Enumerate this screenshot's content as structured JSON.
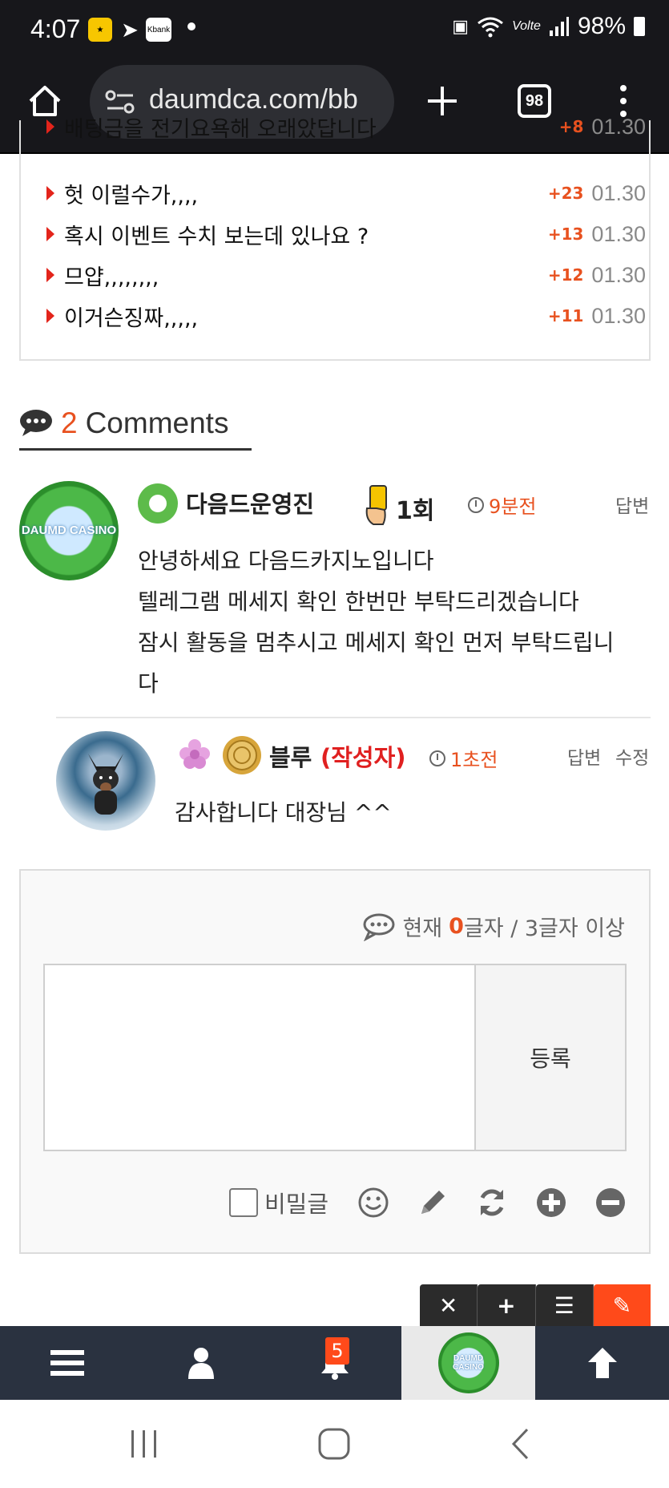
{
  "status_bar": {
    "time": "4:07",
    "app_icon_1": "Kbank",
    "battery": "98%",
    "network": "Volte"
  },
  "browser": {
    "url": "daumdca.com/bb",
    "tab_count": "98"
  },
  "popular_list": [
    {
      "title": "배팅금을 전기요욕해 오래았답니다",
      "count": "+8",
      "date": "01.30"
    },
    {
      "title": "헛 이럴수가,,,,",
      "count": "+23",
      "date": "01.30"
    },
    {
      "title": "혹시 이벤트 수치 보는데 있나요 ?",
      "count": "+13",
      "date": "01.30"
    },
    {
      "title": "므얍,,,,,,,,",
      "count": "+12",
      "date": "01.30"
    },
    {
      "title": "이거슨징짜,,,,,",
      "count": "+11",
      "date": "01.30"
    }
  ],
  "comments_header": {
    "count": "2",
    "label": "Comments"
  },
  "comments": [
    {
      "avatar_text": "DAUMD CASINO",
      "author": "다음드운영진",
      "warning": "1회",
      "time": "9분전",
      "reply": "답변",
      "lines": [
        "안녕하세요 다음드카지노입니다",
        "텔레그램 메세지 확인 한번만 부탁드리겠습니다",
        "잠시 활동을 멈추시고 메세지 확인 먼저 부탁드립니",
        "다"
      ]
    },
    {
      "author": "블루",
      "author_tag": "(작성자)",
      "time": "1초전",
      "reply": "답변",
      "edit": "수정",
      "lines": [
        "감사합니다 대장님 ^^"
      ]
    }
  ],
  "write": {
    "count_prefix": "현재",
    "count_value": "0",
    "count_suffix": "글자 / 3글자 이상",
    "submit": "등록",
    "secret_label": "비밀글"
  },
  "bottom_nav": {
    "badge": "5",
    "logo_text": "DAUMD CASINO"
  },
  "colors": {
    "accent": "#e8511f",
    "dark": "#17171b",
    "nav": "#2a3240"
  }
}
